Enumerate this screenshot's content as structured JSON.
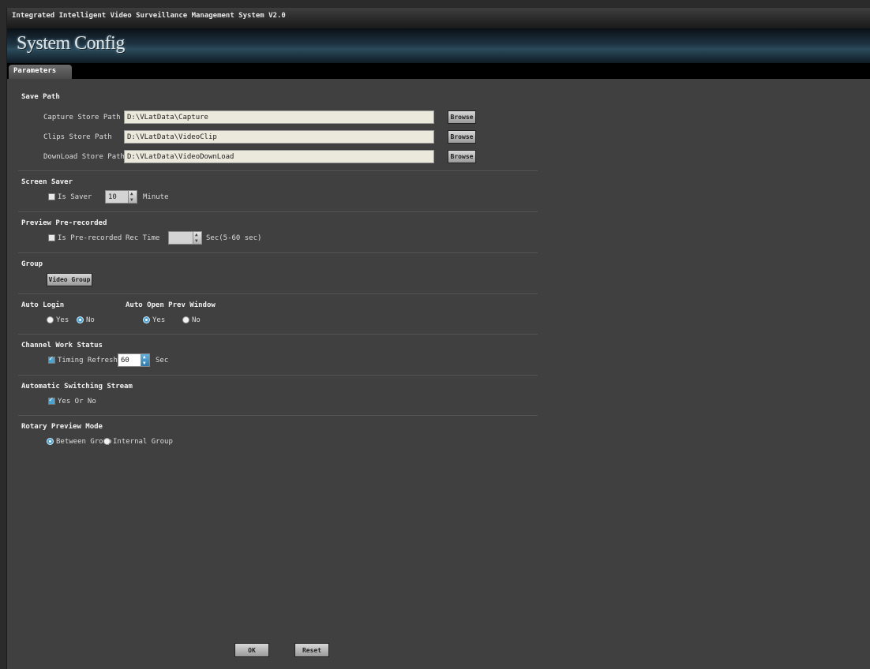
{
  "titlebar": {
    "title": "Integrated Intelligent Video Surveillance Management System V2.0"
  },
  "banner": {
    "title": "System Config"
  },
  "tabs": [
    {
      "label": "Parameters"
    }
  ],
  "save_path": {
    "heading": "Save Path",
    "browse_label": "Browse",
    "rows": [
      {
        "label": "Capture Store Path",
        "value": "D:\\VLatData\\Capture"
      },
      {
        "label": "Clips Store Path",
        "value": "D:\\VLatData\\VideoClip"
      },
      {
        "label": "DownLoad Store Path",
        "value": "D:\\VLatData\\VideoDownLoad"
      }
    ]
  },
  "screen_saver": {
    "heading": "Screen Saver",
    "checkbox_label": "Is Saver",
    "checked": false,
    "value": "10",
    "unit": "Minute"
  },
  "preview_prerecorded": {
    "heading": "Preview Pre-recorded",
    "checkbox_label": "Is Pre-recorded",
    "checked": false,
    "rec_time_label": "Rec Time",
    "value": "",
    "unit": "Sec(5-60 sec)"
  },
  "group": {
    "heading": "Group",
    "button_label": "Video Group"
  },
  "auto_login": {
    "heading": "Auto Login",
    "options": [
      {
        "label": "Yes",
        "selected": false
      },
      {
        "label": "No",
        "selected": true
      }
    ]
  },
  "auto_open_preview": {
    "heading": "Auto Open Prev Window",
    "options": [
      {
        "label": "Yes",
        "selected": true
      },
      {
        "label": "No",
        "selected": false
      }
    ]
  },
  "channel_work_status": {
    "heading": "Channel Work Status",
    "checkbox_label": "Timing Refresh",
    "checked": true,
    "value": "60",
    "unit": "Sec"
  },
  "auto_switch_stream": {
    "heading": "Automatic Switching Stream",
    "checkbox_label": "Yes Or No",
    "checked": true
  },
  "rotary_preview": {
    "heading": "Rotary Preview Mode",
    "options": [
      {
        "label": "Between Group",
        "selected": true
      },
      {
        "label": "Internal Group",
        "selected": false
      }
    ]
  },
  "footer": {
    "ok_label": "OK",
    "reset_label": "Reset"
  },
  "colors": {
    "accent": "#4aa3d0",
    "panel": "#404040",
    "field": "#ebe8dc"
  }
}
